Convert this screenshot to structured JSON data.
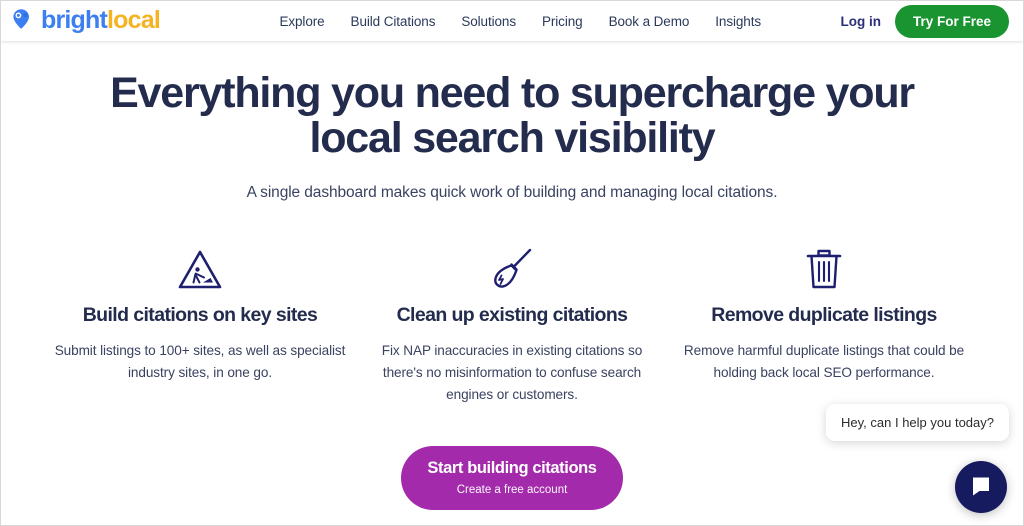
{
  "header": {
    "logo": {
      "icon": "map-pin-icon",
      "text_primary": "bright",
      "text_secondary": "local",
      "color_primary": "#3d7ff0",
      "color_secondary": "#f5b324"
    },
    "nav": [
      {
        "label": "Explore"
      },
      {
        "label": "Build Citations"
      },
      {
        "label": "Solutions"
      },
      {
        "label": "Pricing"
      },
      {
        "label": "Book a Demo"
      },
      {
        "label": "Insights"
      }
    ],
    "login_label": "Log in",
    "try_free_label": "Try For Free",
    "try_free_color": "#1a9431"
  },
  "hero": {
    "title": "Everything you need to supercharge your local search visibility",
    "subtitle": "A single dashboard makes quick work of building and managing local citations."
  },
  "features": [
    {
      "icon": "construction-sign-icon",
      "title": "Build citations on key sites",
      "description": "Submit listings to 100+ sites, as well as specialist industry sites, in one go."
    },
    {
      "icon": "broom-icon",
      "title": "Clean up existing citations",
      "description": "Fix NAP inaccuracies in existing citations so there's no misinformation to confuse search engines or customers."
    },
    {
      "icon": "trash-can-icon",
      "title": "Remove duplicate listings",
      "description": "Remove harmful duplicate listings that could be holding back local SEO performance."
    }
  ],
  "cta": {
    "main_label": "Start building citations",
    "sub_label": "Create a free account",
    "color": "#a32bab"
  },
  "chat": {
    "bubble_message": "Hey, can I help you today?",
    "launcher_icon": "chat-bubble-icon",
    "launcher_color": "#161a5e"
  }
}
